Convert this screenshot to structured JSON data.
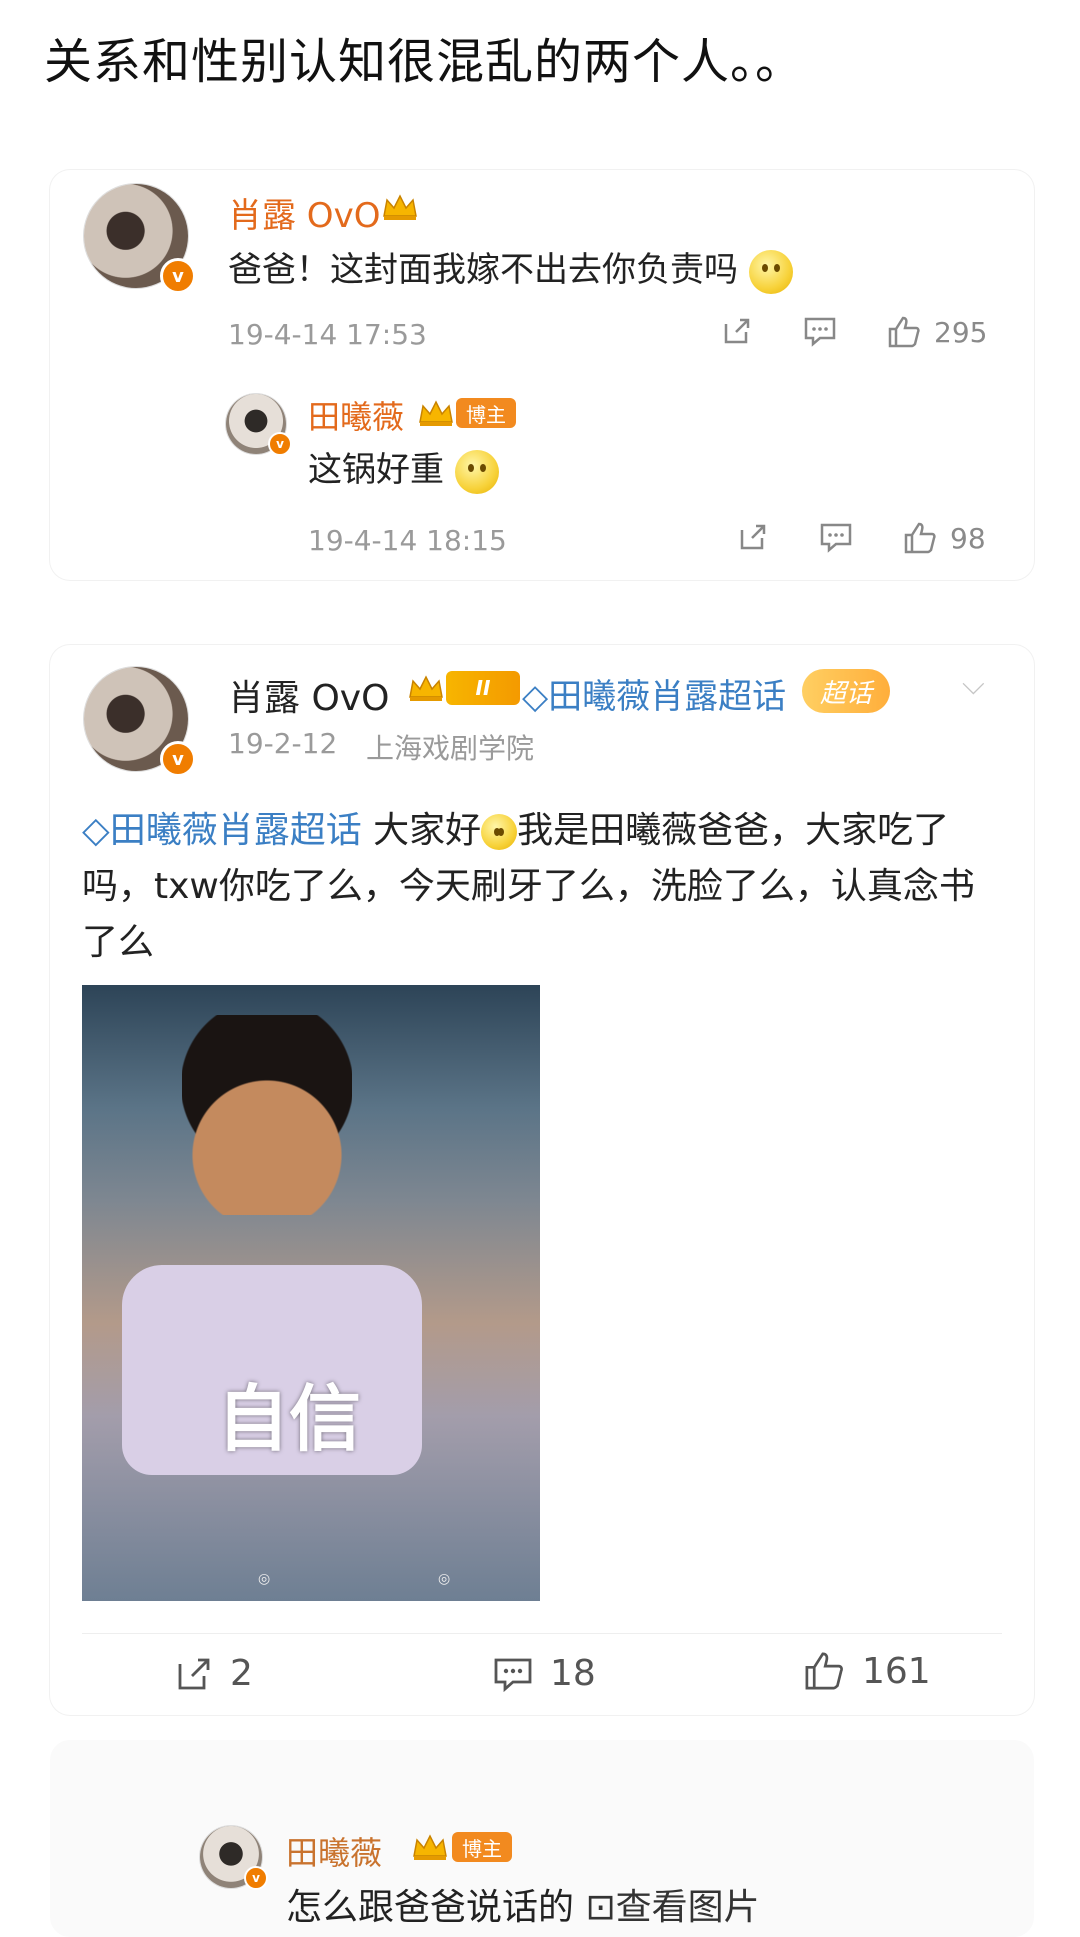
{
  "caption": "关系和性别认知很混乱的两个人。。",
  "comment1": {
    "username": "肖露 OvO",
    "text": "爸爸！这封面我嫁不出去你负责吗",
    "timestamp": "19-4-14 17:53",
    "like_count": "295",
    "reply": {
      "username": "田曦薇",
      "badge": "博主",
      "text": "这锅好重",
      "timestamp": "19-4-14 18:15",
      "like_count": "98"
    }
  },
  "post": {
    "username": "肖露 OvO",
    "vip_level": "II",
    "topic": "田曦薇肖露超话",
    "chaohua_badge": "超话",
    "date": "19-2-12",
    "location": "上海戏剧学院",
    "topic_link": "田曦薇肖露超话",
    "text_a": " 大家好",
    "text_b": "我是田曦薇爸爸，大家吃了吗，txw你吃了么，今天刷牙了么，洗脸了么，认真念书了么",
    "image_caption": "自信",
    "repost_count": "2",
    "comment_count": "18",
    "like_count": "161"
  },
  "comment3": {
    "username": "田曦薇",
    "badge": "博主",
    "text": "怎么跟爸爸说话的",
    "view_image": "查看图片"
  },
  "colors": {
    "accent_orange": "#e36a1c",
    "link_blue": "#3b7fc4",
    "meta_gray": "#9a9a9a"
  }
}
